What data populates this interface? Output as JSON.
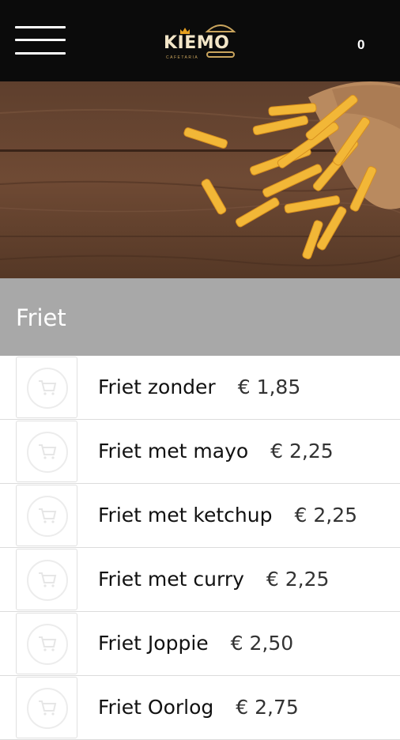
{
  "header": {
    "logo_text": "KIEMO",
    "logo_subtext": "CAFETARIA",
    "cart_count": "0",
    "icons": [
      "hamburger-menu-icon",
      "crown-icon",
      "sandwich-icon"
    ]
  },
  "hero": {
    "image": "fries-cone-on-wooden-table"
  },
  "category": {
    "title": "Friet"
  },
  "products": [
    {
      "name": "Friet zonder",
      "price": "€ 1,85"
    },
    {
      "name": "Friet met mayo",
      "price": "€ 2,25"
    },
    {
      "name": "Friet met ketchup",
      "price": "€ 2,25"
    },
    {
      "name": "Friet met curry",
      "price": "€ 2,25"
    },
    {
      "name": "Friet Joppie",
      "price": "€ 2,50"
    },
    {
      "name": "Friet Oorlog",
      "price": "€ 2,75"
    }
  ],
  "colors": {
    "topbar": "#0b0b0b",
    "category_bar": "#a8a8a8",
    "logo_gold": "#c9a45d"
  }
}
